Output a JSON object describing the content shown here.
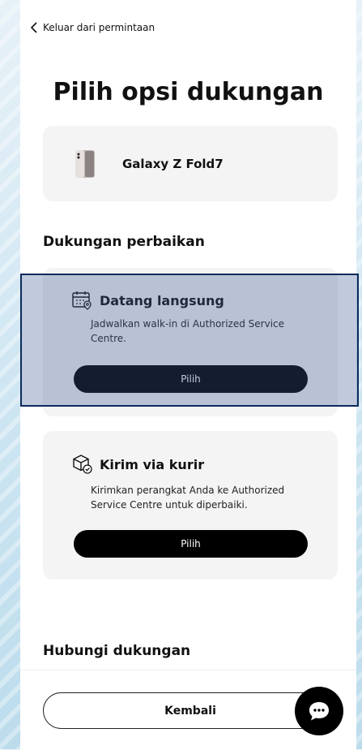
{
  "back_link": "Keluar dari permintaan",
  "page_title": "Pilih opsi dukungan",
  "product": {
    "name": "Galaxy Z Fold7"
  },
  "repair_section_title": "Dukungan perbaikan",
  "options": [
    {
      "title": "Datang langsung",
      "description": "Jadwalkan walk-in di Authorized Service Centre.",
      "button_label": "Pilih",
      "icon": "calendar-location-icon"
    },
    {
      "title": "Kirim via kurir",
      "description": "Kirimkan perangkat Anda ke Authorized Service Centre untuk diperbaiki.",
      "button_label": "Pilih",
      "icon": "package-delivery-icon"
    }
  ],
  "contact_section_title": "Hubungi dukungan",
  "back_button_label": "Kembali",
  "chat_icon": "chat-bubble-icon",
  "colors": {
    "button": "#000000",
    "highlight": "#0b2a5c"
  }
}
